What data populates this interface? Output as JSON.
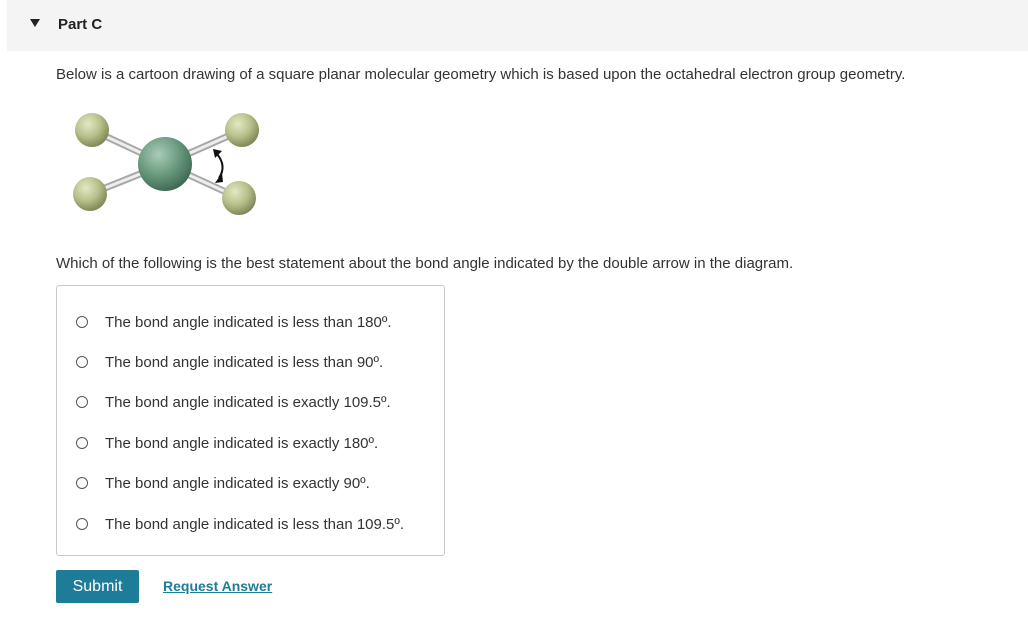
{
  "part": {
    "title": "Part C"
  },
  "intro_text": "Below is a cartoon drawing of a square planar molecular geometry which is based upon the octahedral electron group geometry.",
  "question_text": "Which of the following is the best statement about the bond angle indicated by the double arrow in the diagram.",
  "choices": [
    {
      "label": "The bond angle indicated is less than 180º."
    },
    {
      "label": "The bond angle indicated is less than 90º."
    },
    {
      "label": "The bond angle indicated is exactly 109.5º."
    },
    {
      "label": "The bond angle indicated is exactly 180º."
    },
    {
      "label": "The bond angle indicated is exactly 90º."
    },
    {
      "label": "The bond angle indicated is less than 109.5º."
    }
  ],
  "actions": {
    "submit_label": "Submit",
    "request_answer_label": "Request Answer"
  },
  "colors": {
    "accent": "#1f7c98",
    "central_atom": "#6a9a7e",
    "ligand_atom": "#b7c08a"
  }
}
